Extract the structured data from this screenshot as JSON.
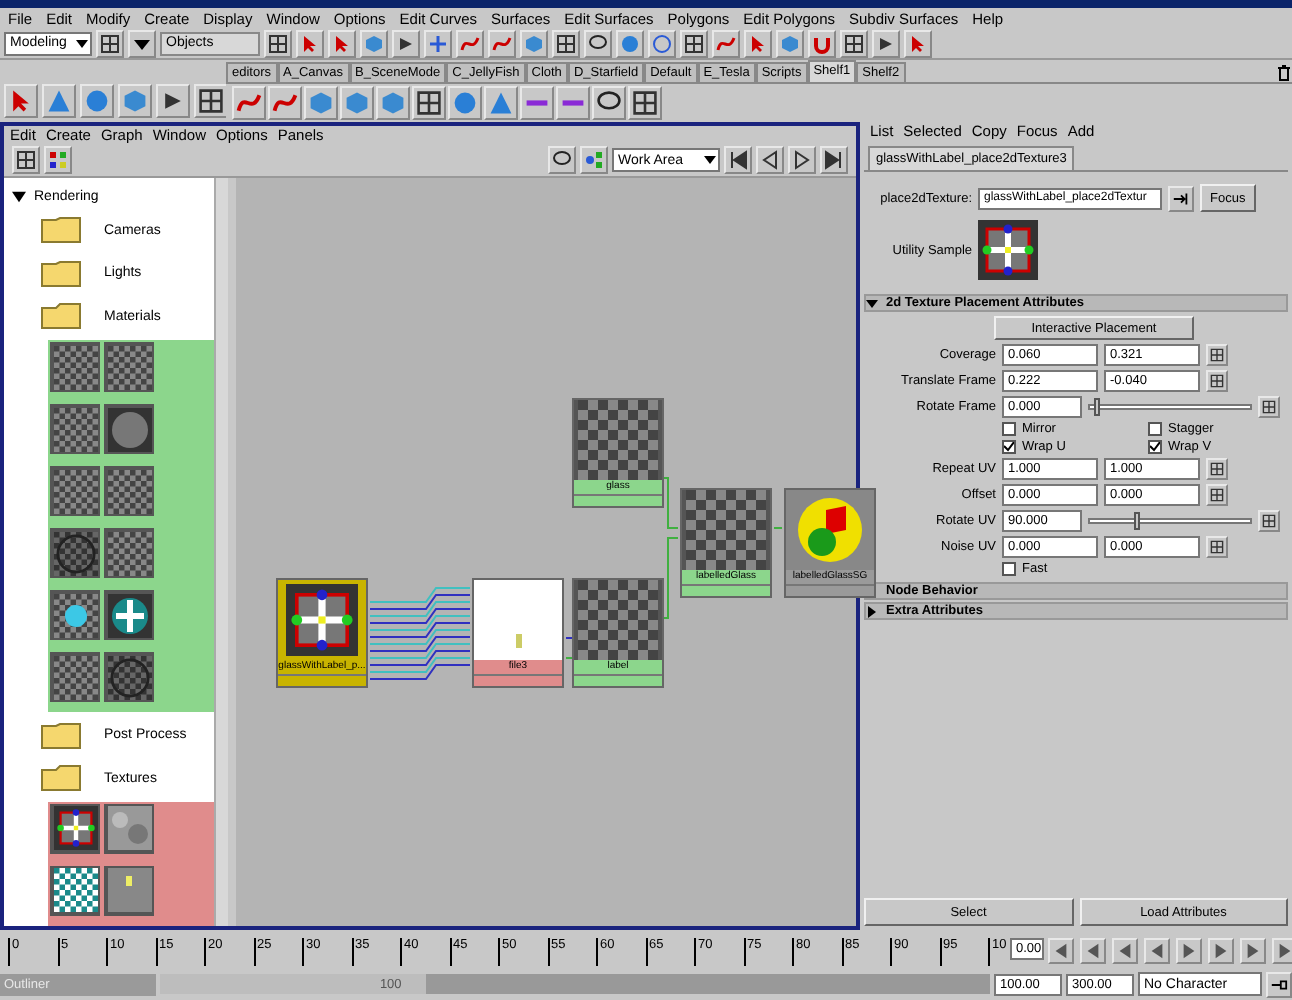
{
  "menu_bar": [
    "File",
    "Edit",
    "Modify",
    "Create",
    "Display",
    "Window",
    "Options",
    "Edit Curves",
    "Surfaces",
    "Edit Surfaces",
    "Polygons",
    "Edit Polygons",
    "Subdiv Surfaces",
    "Help"
  ],
  "status_line": {
    "mode": "Modeling",
    "objects_field": "Objects"
  },
  "shelf_tabs": [
    {
      "label": "editors",
      "selected": false
    },
    {
      "label": "A_Canvas",
      "selected": false
    },
    {
      "label": "B_SceneMode",
      "selected": false
    },
    {
      "label": "C_JellyFish",
      "selected": false
    },
    {
      "label": "Cloth",
      "selected": false
    },
    {
      "label": "D_Starfield",
      "selected": false
    },
    {
      "label": "Default",
      "selected": false
    },
    {
      "label": "E_Tesla",
      "selected": false
    },
    {
      "label": "Scripts",
      "selected": false
    },
    {
      "label": "Shelf1",
      "selected": true
    },
    {
      "label": "Shelf2",
      "selected": false
    }
  ],
  "hypershade": {
    "menu": [
      "Edit",
      "Create",
      "Graph",
      "Window",
      "Options",
      "Panels"
    ],
    "work_area_dropdown": "Work Area",
    "tree": [
      {
        "label": "Rendering",
        "expanded": true,
        "children": [
          {
            "label": "Cameras",
            "expanded": false
          },
          {
            "label": "Lights",
            "expanded": false
          },
          {
            "label": "Materials",
            "expanded": true,
            "swatches": [
              {
                "kind": "checker"
              },
              {
                "kind": "checker"
              },
              {
                "kind": "checker"
              },
              {
                "kind": "sphere"
              },
              {
                "kind": "checker"
              },
              {
                "kind": "checker"
              },
              {
                "kind": "darksphere"
              },
              {
                "kind": "checker"
              },
              {
                "kind": "glow"
              },
              {
                "kind": "ball"
              },
              {
                "kind": "checker"
              },
              {
                "kind": "darksphere"
              }
            ]
          },
          {
            "label": "Post Process",
            "expanded": false
          },
          {
            "label": "Textures",
            "expanded": true,
            "swatches": [
              {
                "kind": "place2d"
              },
              {
                "kind": "noise"
              },
              {
                "kind": "tealchecker"
              },
              {
                "kind": "file"
              }
            ]
          }
        ]
      }
    ],
    "nodes": [
      {
        "label": "glassWithLabel_p...",
        "kind": "place2d"
      },
      {
        "label": "file3",
        "kind": "file"
      },
      {
        "label": "glass",
        "kind": "material"
      },
      {
        "label": "label",
        "kind": "material"
      },
      {
        "label": "labelledGlass",
        "kind": "material"
      },
      {
        "label": "labelledGlassSG",
        "kind": "group"
      }
    ]
  },
  "attribute_editor": {
    "menu": [
      "List",
      "Selected",
      "Copy",
      "Focus",
      "Add"
    ],
    "tab": "glassWithLabel_place2dTexture3",
    "node_label": "place2dTexture:",
    "node_name": "glassWithLabel_place2dTextur",
    "focus_button": "Focus",
    "sample_label": "Utility Sample",
    "sections": [
      {
        "title": "2d Texture Placement Attributes",
        "expanded": true,
        "button": "Interactive Placement",
        "rows": [
          {
            "kind": "pair",
            "label": "Coverage",
            "values": [
              "0.060",
              "0.321"
            ]
          },
          {
            "kind": "pair",
            "label": "Translate Frame",
            "values": [
              "0.222",
              "-0.040"
            ]
          },
          {
            "kind": "slider",
            "label": "Rotate Frame",
            "value": "0.000",
            "level": 0.02
          },
          {
            "kind": "checks",
            "items": [
              {
                "label": "Mirror",
                "checked": false
              },
              {
                "label": "Stagger",
                "checked": false
              }
            ]
          },
          {
            "kind": "checks",
            "items": [
              {
                "label": "Wrap U",
                "checked": true
              },
              {
                "label": "Wrap V",
                "checked": true
              }
            ]
          },
          {
            "kind": "pair",
            "label": "Repeat UV",
            "values": [
              "1.000",
              "1.000"
            ]
          },
          {
            "kind": "pair",
            "label": "Offset",
            "values": [
              "0.000",
              "0.000"
            ]
          },
          {
            "kind": "slider",
            "label": "Rotate UV",
            "value": "90.000",
            "level": 0.28
          },
          {
            "kind": "pair",
            "label": "Noise UV",
            "values": [
              "0.000",
              "0.000"
            ]
          },
          {
            "kind": "checks",
            "items": [
              {
                "label": "Fast",
                "checked": false
              }
            ]
          }
        ]
      },
      {
        "title": "Node Behavior",
        "expanded": false
      },
      {
        "title": "Extra Attributes",
        "expanded": false
      }
    ],
    "buttons": [
      "Select",
      "Load Attributes"
    ]
  },
  "time_slider": {
    "ticks": [
      "0",
      "5",
      "10",
      "15",
      "20",
      "25",
      "30",
      "35",
      "40",
      "45",
      "50",
      "55",
      "60",
      "65",
      "70",
      "75",
      "80",
      "85",
      "90",
      "95",
      "10"
    ],
    "current_time": "0.00"
  },
  "range_slider": {
    "outliner_title": "Outliner",
    "range_label": "100",
    "level": 0.32,
    "start": "100.00",
    "end": "300.00",
    "character": "No Character"
  }
}
